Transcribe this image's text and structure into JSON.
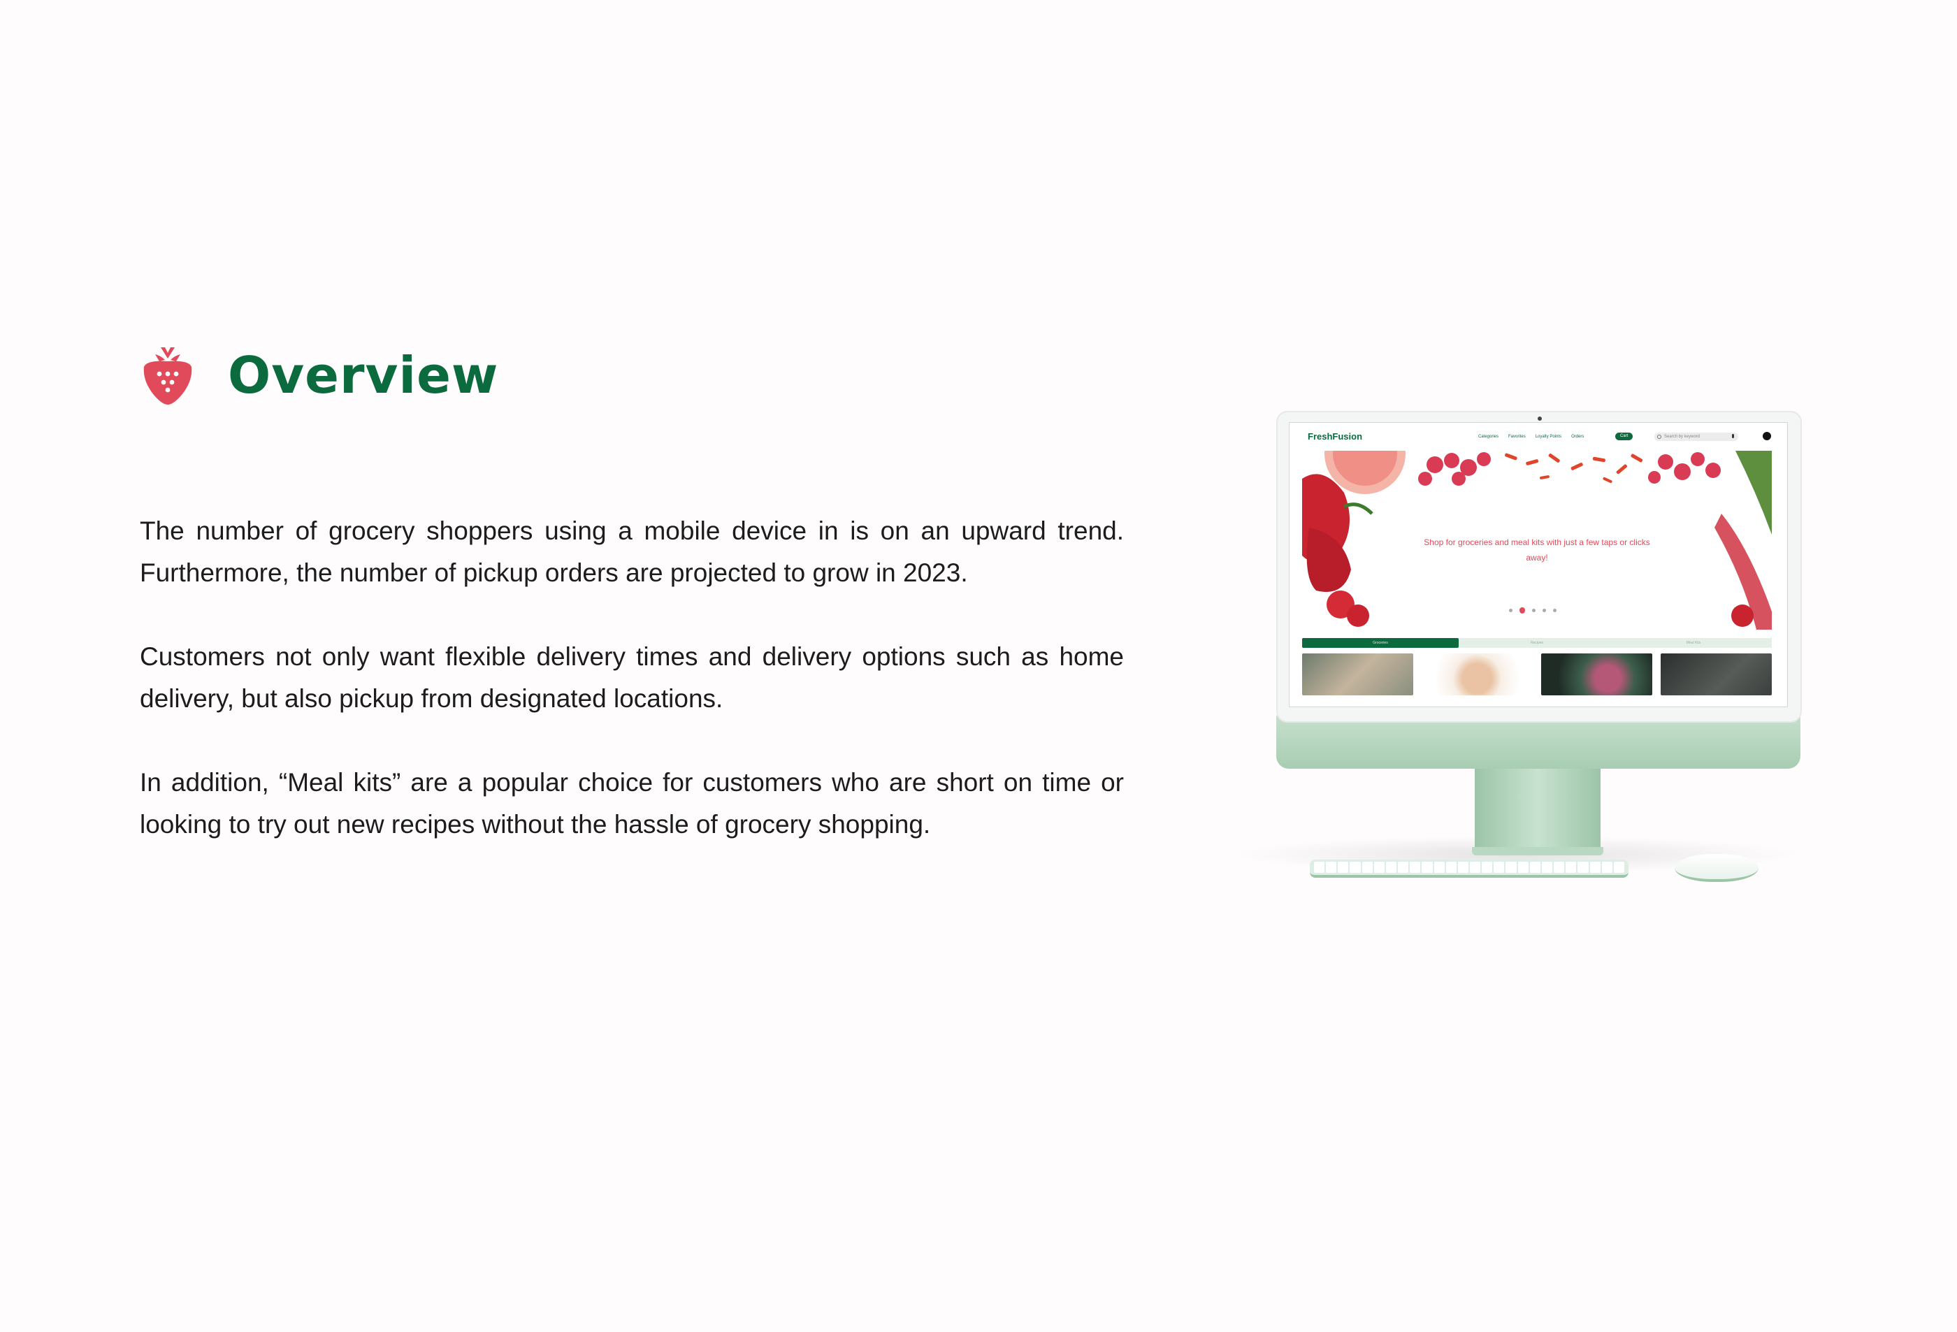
{
  "page": {
    "title": "Overview",
    "paragraphs": [
      "The number of grocery shoppers using a mobile device in is on an upward trend. Furthermore, the number of pickup orders are projected to grow in 2023.",
      "Customers not only want flexible delivery times and delivery options such as home delivery, but also pickup from designated locations.",
      "In addition, “Meal kits” are a popular choice for customers who are short on time or looking to try out new recipes without the hassle of grocery shopping."
    ],
    "icon": "strawberry-icon"
  },
  "mockup": {
    "brand": "FreshFusion",
    "nav": [
      "Categories",
      "Favorites",
      "Loyalty Points",
      "Orders"
    ],
    "cart_label": "Cart",
    "search_placeholder": "Search by keyword",
    "hero_text": "Shop for groceries and meal kits with just a few taps or clicks away!",
    "carousel": {
      "count": 5,
      "active": 2
    },
    "tabs": [
      "Groceries",
      "Recipes",
      "Meal Kits"
    ],
    "colors": {
      "brand_green": "#0b6b3e",
      "accent_red": "#e04a5a",
      "imac_green": "#b7d8bf"
    }
  }
}
